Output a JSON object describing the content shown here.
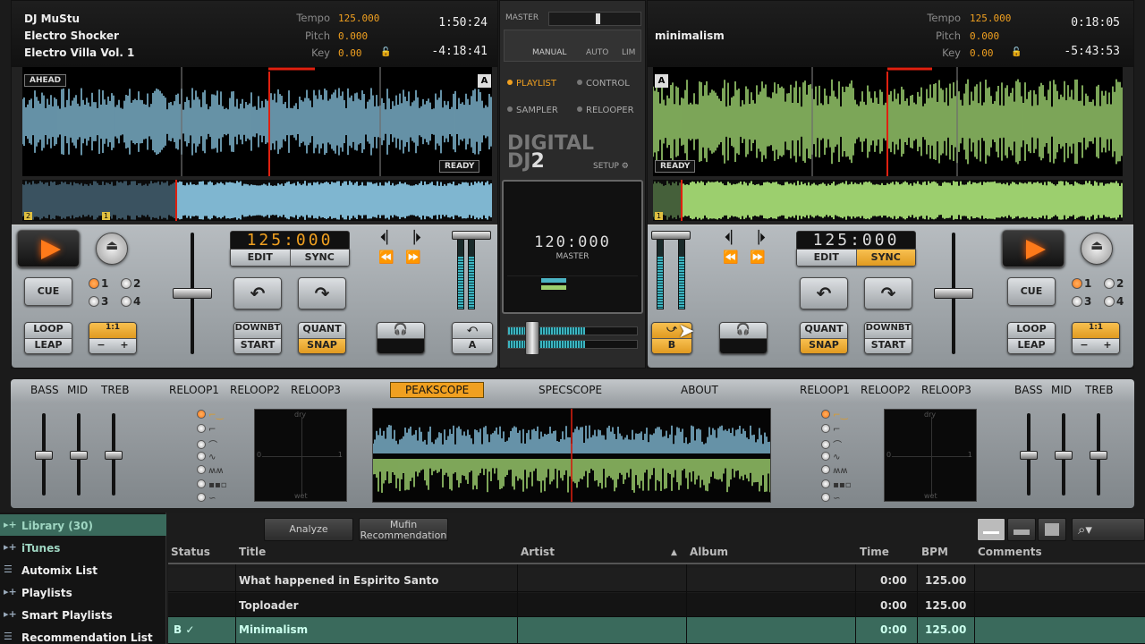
{
  "deckA": {
    "artist": "DJ MuStu",
    "title": "Electro Shocker",
    "album": "Electro Villa Vol. 1",
    "tempo_label": "Tempo",
    "tempo": "125.000",
    "pitch_label": "Pitch",
    "pitch": "0.000",
    "key_label": "Key",
    "key": "0.00",
    "elapsed": "1:50:24",
    "remaining": "-4:18:41",
    "badge_ahead": "AHEAD",
    "badge_ready": "READY",
    "deck_letter": "A",
    "bpm_display": "125:000",
    "edit": "EDIT",
    "sync": "SYNC",
    "cue": "CUE",
    "loop": "LOOP",
    "leap": "LEAP",
    "loop_size": "1:1",
    "minus": "−",
    "plus": "+",
    "downbt": "DOWNBT",
    "start": "START",
    "quant": "QUANT",
    "snap": "SNAP",
    "hotcues": [
      "1",
      "2",
      "3",
      "4"
    ],
    "overview_markers": [
      "2",
      "1"
    ]
  },
  "deckB": {
    "title": "minimalism",
    "tempo_label": "Tempo",
    "tempo": "125.000",
    "pitch_label": "Pitch",
    "pitch": "0.000",
    "key_label": "Key",
    "key": "0.00",
    "elapsed": "0:18:05",
    "remaining": "-5:43:53",
    "badge_ready": "READY",
    "deck_letter": "A",
    "bpm_display": "125:000",
    "edit": "EDIT",
    "sync": "SYNC",
    "cue": "CUE",
    "loop": "LOOP",
    "leap": "LEAP",
    "loop_size": "1:1",
    "minus": "−",
    "plus": "+",
    "downbt": "DOWNBT",
    "start": "START",
    "quant": "QUANT",
    "snap": "SNAP",
    "hotcues": [
      "1",
      "2",
      "3",
      "4"
    ],
    "overview_markers": [
      "1"
    ]
  },
  "mixer": {
    "master": "MASTER",
    "manual": "MANUAL",
    "auto": "AUTO",
    "lim": "LIM",
    "playlist": "PLAYLIST",
    "control": "CONTROL",
    "sampler": "SAMPLER",
    "relooper": "RELOOPER",
    "logo_line1": "DIGITAL",
    "logo_line2": "DJ",
    "logo_num": "2",
    "setup": "SETUP",
    "bpm": "120:000",
    "bpm_label": "MASTER",
    "xfader_a": "A",
    "xfader_b": "B"
  },
  "fx": {
    "left": [
      "BASS",
      "MID",
      "TREB",
      "RELOOP1",
      "RELOOP2",
      "RELOOP3"
    ],
    "tabs": [
      "PEAKSCOPE",
      "SPECSCOPE",
      "ABOUT"
    ],
    "right": [
      "RELOOP1",
      "RELOOP2",
      "RELOOP3",
      "BASS",
      "MID",
      "TREB"
    ],
    "pad_dry": "dry",
    "pad_wet": "wet",
    "pad_one": "1",
    "pad_zero": "0"
  },
  "library": {
    "sidebar": [
      "Library (30)",
      "iTunes",
      "Automix List",
      "Playlists",
      "Smart Playlists",
      "Recommendation List"
    ],
    "analyze": "Analyze",
    "mufin_line1": "Mufin",
    "mufin_line2": "Recommendation",
    "columns": [
      "Status",
      "Title",
      "Artist",
      "Album",
      "Time",
      "BPM",
      "Comments"
    ],
    "rows": [
      {
        "status": "",
        "title": "What happened in Espirito Santo",
        "time": "0:00",
        "bpm": "125.00"
      },
      {
        "status": "",
        "title": "Toploader",
        "time": "0:00",
        "bpm": "125.00"
      },
      {
        "status": "B ✓",
        "title": "Minimalism",
        "time": "0:00",
        "bpm": "125.00"
      }
    ]
  },
  "colors": {
    "accent": "#f0a020",
    "waveA": "#7fb6d0",
    "waveB": "#9ccf6e",
    "selected_row": "#3a6a5c"
  }
}
